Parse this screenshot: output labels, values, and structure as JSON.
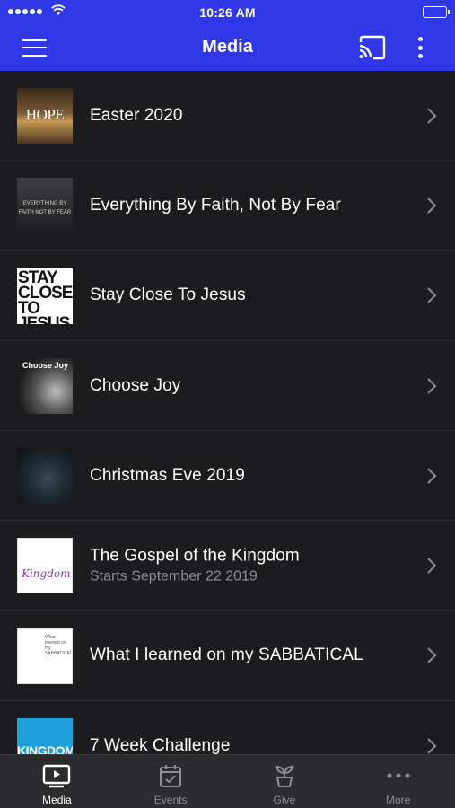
{
  "status_bar": {
    "time": "10:26 AM"
  },
  "nav": {
    "title": "Media"
  },
  "colors": {
    "brand_blue": "#2f37e6",
    "background": "#1c1c1e",
    "secondary_text": "#8e8e93"
  },
  "media": {
    "items": [
      {
        "title": "Easter 2020",
        "subtitle": "",
        "thumb_text": "HOPE"
      },
      {
        "title": "Everything By Faith, Not By Fear",
        "subtitle": "",
        "thumb_text": "EVERYTHING BY FAITH NOT BY FEAR"
      },
      {
        "title": "Stay Close To Jesus",
        "subtitle": "",
        "thumb_text": "STAY CLOSE TO JESUS"
      },
      {
        "title": "Choose Joy",
        "subtitle": "",
        "thumb_text": "Choose Joy"
      },
      {
        "title": "Christmas Eve 2019",
        "subtitle": "",
        "thumb_text": ""
      },
      {
        "title": "The Gospel of the Kingdom",
        "subtitle": "Starts September 22 2019",
        "thumb_text": "Kingdom"
      },
      {
        "title": "What I learned on my SABBATICAL",
        "subtitle": "",
        "thumb_text": "What I learned on my SABBATICAL"
      },
      {
        "title": "7 Week Challenge",
        "subtitle": "",
        "thumb_text": "KINGDOM"
      }
    ]
  },
  "tabs": [
    {
      "label": "Media",
      "icon": "tv-play-icon",
      "active": true
    },
    {
      "label": "Events",
      "icon": "calendar-check-icon",
      "active": false
    },
    {
      "label": "Give",
      "icon": "plant-icon",
      "active": false
    },
    {
      "label": "More",
      "icon": "more-horizontal-icon",
      "active": false
    }
  ]
}
